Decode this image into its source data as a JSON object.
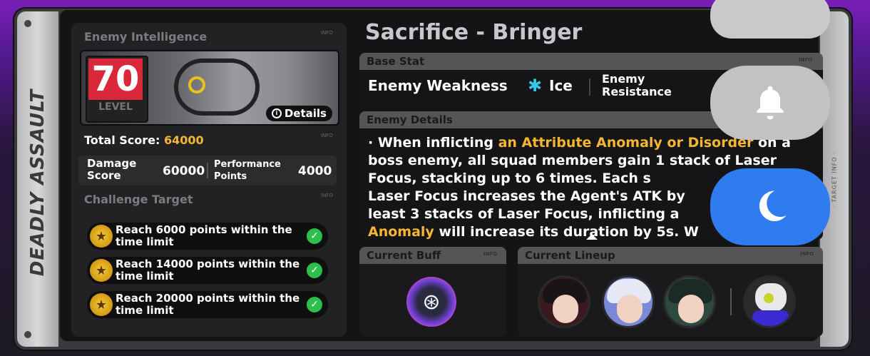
{
  "side_title": "DEADLY ASSAULT",
  "right_side_label": "· TARGET INFO ·",
  "enemy_intelligence": {
    "title": "Enemy Intelligence",
    "info": "INFO",
    "level": "70",
    "level_label": "LEVEL",
    "details_button": "Details"
  },
  "total_score": {
    "label": "Total Score:",
    "value": "64000",
    "info": "INFO"
  },
  "scores": {
    "damage_label": "Damage Score",
    "damage_value": "60000",
    "performance_label": "Performance Points",
    "performance_value": "4000"
  },
  "challenge": {
    "title": "Challenge Target",
    "info": "INFO",
    "targets": [
      {
        "text": "Reach 6000 points within the time limit"
      },
      {
        "text": "Reach 14000 points within the time limit"
      },
      {
        "text": "Reach 20000 points within the time limit"
      }
    ]
  },
  "boss": {
    "name": "Sacrifice - Bringer"
  },
  "base_stat": {
    "title": "Base Stat",
    "info": "INFO",
    "weakness_label": "Enemy Weakness",
    "weakness_value": "Ice",
    "resistance_label": "Enemy Resistance"
  },
  "enemy_details": {
    "title": "Enemy Details",
    "p1": "· When inflicting ",
    "hl1": "an Attribute Anomaly or Disorder",
    "p2": " on a boss enemy, all squad members gain 1 stack of Laser Focus, stacking up to 6 times. Each s",
    "p3": "Laser Focus increases the Agent's ATK by",
    "p4": "least 3 stacks of Laser Focus, inflicting a",
    "hl2": "Anomaly",
    "p5": " will increase its duration by 5s. W"
  },
  "current_buff": {
    "title": "Current Buff",
    "info": "INFO"
  },
  "current_lineup": {
    "title": "Current Lineup",
    "info": "INFO"
  },
  "colors": {
    "accent_yellow": "#f5b731",
    "level_red": "#d8283a",
    "ice_blue": "#36c5e8",
    "moon_button": "#2f7cf0"
  },
  "icons": [
    "details-icon",
    "ice-icon",
    "check-icon",
    "coin-icon",
    "buff-icon",
    "bell-icon",
    "moon-icon"
  ]
}
